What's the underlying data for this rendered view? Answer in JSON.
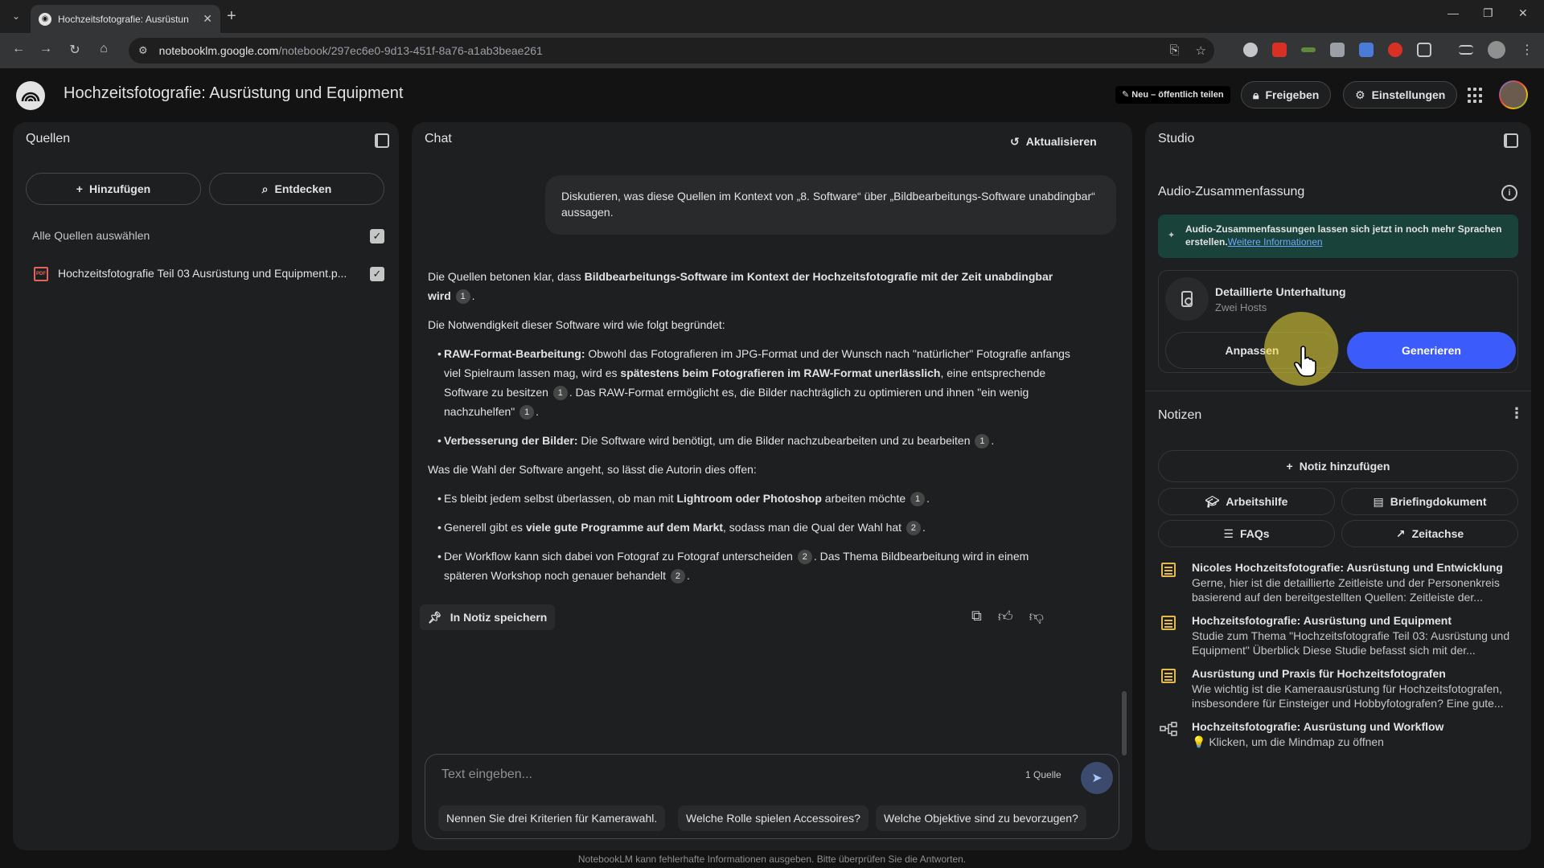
{
  "browser": {
    "tab_title": "Hochzeitsfotografie: Ausrüstun",
    "url_host": "notebooklm.google.com",
    "url_path": "/notebook/297ec6e0-9d13-451f-8a76-a1ab3beae261"
  },
  "header": {
    "title": "Hochzeitsfotografie: Ausrüstung und Equipment",
    "new_badge": "Neu – öffentlich teilen",
    "share_label": "Freigeben",
    "settings_label": "Einstellungen"
  },
  "sources": {
    "title": "Quellen",
    "add_label": "Hinzufügen",
    "discover_label": "Entdecken",
    "select_all_label": "Alle Quellen auswählen",
    "items": [
      {
        "label": "Hochzeitsfotografie Teil 03 Ausrüstung und Equipment.p...",
        "checked": true
      }
    ]
  },
  "chat": {
    "title": "Chat",
    "refresh_label": "Aktualisieren",
    "user_message": "Diskutieren, was diese Quellen im Kontext von „8. Software“ über „Bildbearbeitungs-Software unabdingbar“ aussagen.",
    "answer": {
      "p1_pre": "Die Quellen betonen klar, dass ",
      "p1_bold": "Bildbearbeitungs-Software im Kontext der Hochzeitsfotografie mit der Zeit unabdingbar wird",
      "p1_cite": "1",
      "p2": "Die Notwendigkeit dieser Software wird wie folgt begründet:",
      "b1_bold": "RAW-Format-Bearbeitung:",
      "b1_text1": " Obwohl das Fotografieren im JPG-Format und der Wunsch nach \"natürlicher\" Fotografie anfangs viel Spielraum lassen mag, wird es ",
      "b1_bold2": "spätestens beim Fotografieren im RAW-Format unerlässlich",
      "b1_text2": ", eine entsprechende Software zu besitzen",
      "b1_cite1": "1",
      "b1_text3": ". Das RAW-Format ermöglicht es, die Bilder nachträglich zu optimieren und ihnen \"ein wenig nachzuhelfen\"",
      "b1_cite2": "1",
      "b2_bold": "Verbesserung der Bilder:",
      "b2_text": " Die Software wird benötigt, um die Bilder nachzubearbeiten und zu bearbeiten",
      "b2_cite": "1",
      "p3": "Was die Wahl der Software angeht, so lässt die Autorin dies offen:",
      "b3_text1": "Es bleibt jedem selbst überlassen, ob man mit ",
      "b3_bold": "Lightroom oder Photoshop",
      "b3_text2": " arbeiten möchte",
      "b3_cite": "1",
      "b4_text1": "Generell gibt es ",
      "b4_bold": "viele gute Programme auf dem Markt",
      "b4_text2": ", sodass man die Qual der Wahl hat",
      "b4_cite": "2",
      "b5_text1": "Der Workflow kann sich dabei von Fotograf zu Fotograf unterscheiden",
      "b5_cite1": "2",
      "b5_text2": ". Das Thema Bildbearbeitung wird in einem späteren Workshop noch genauer behandelt",
      "b5_cite2": "2"
    },
    "save_note_label": "In Notiz speichern",
    "input_placeholder": "Text eingeben...",
    "source_count": "1 Quelle",
    "suggestions": [
      "Nennen Sie drei Kriterien für Kamerawahl.",
      "Welche Rolle spielen Accessoires?",
      "Welche Objektive sind zu bevorzugen?"
    ]
  },
  "studio": {
    "title": "Studio",
    "audio_title": "Audio-Zusammenfassung",
    "banner_text": "Audio-Zusammenfassungen lassen sich jetzt in noch mehr Sprachen erstellen.",
    "banner_link": "Weitere Informationen",
    "audio_card_title": "Detaillierte Unterhaltung",
    "audio_card_sub": "Zwei Hosts",
    "customize_label": "Anpassen",
    "generate_label": "Generieren",
    "notes_title": "Notizen",
    "add_note_label": "Notiz hinzufügen",
    "tools": [
      "Arbeitshilfe",
      "Briefingdokument",
      "FAQs",
      "Zeitachse"
    ],
    "notes": [
      {
        "title": "Nicoles Hochzeitsfotografie: Ausrüstung und Entwicklung",
        "body": "Gerne, hier ist die detaillierte Zeitleiste und der Personenkreis basierend auf den bereitgestellten Quellen: Zeitleiste der..."
      },
      {
        "title": "Hochzeitsfotografie: Ausrüstung und Equipment",
        "body": "Studie zum Thema \"Hochzeitsfotografie Teil 03: Ausrüstung und Equipment\" Überblick Diese Studie befasst sich mit der..."
      },
      {
        "title": "Ausrüstung und Praxis für Hochzeitsfotografen",
        "body": "Wie wichtig ist die Kameraausrüstung für Hochzeitsfotografen, insbesondere für Einsteiger und Hobbyfotografen? Eine gute..."
      },
      {
        "title": "Hochzeitsfotografie: Ausrüstung und Workflow",
        "body": "💡 Klicken, um die Mindmap zu öffnen"
      }
    ]
  },
  "footer": "NotebookLM kann fehlerhafte Informationen ausgeben. Bitte überprüfen Sie die Antworten."
}
